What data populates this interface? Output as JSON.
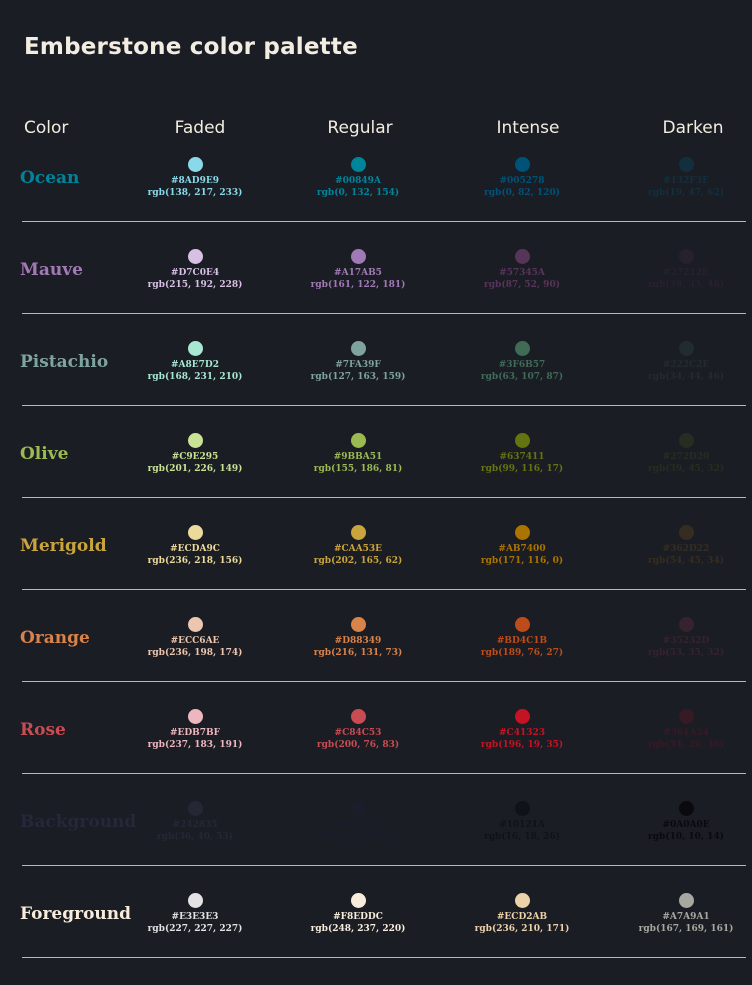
{
  "title": "Emberstone color palette",
  "headers": [
    "Color",
    "Faded",
    "Regular",
    "Intense",
    "Darken"
  ],
  "rows": [
    {
      "name": "Ocean",
      "name_color": "#00849A",
      "swatches": [
        {
          "hex": "#8AD9E9",
          "rgb": "rgb(138, 217, 233)"
        },
        {
          "hex": "#00849A",
          "rgb": "rgb(0, 132, 154)"
        },
        {
          "hex": "#005278",
          "rgb": "rgb(0, 82, 120)"
        },
        {
          "hex": "#132F3E",
          "rgb": "rgb(19, 47, 62)"
        }
      ]
    },
    {
      "name": "Mauve",
      "name_color": "#A17AB5",
      "swatches": [
        {
          "hex": "#D7C0E4",
          "rgb": "rgb(215, 192, 228)"
        },
        {
          "hex": "#A17AB5",
          "rgb": "rgb(161, 122, 181)"
        },
        {
          "hex": "#57345A",
          "rgb": "rgb(87, 52, 90)"
        },
        {
          "hex": "#27212E",
          "rgb": "rgb(39, 33, 46)"
        }
      ]
    },
    {
      "name": "Pistachio",
      "name_color": "#7FA39F",
      "swatches": [
        {
          "hex": "#A8E7D2",
          "rgb": "rgb(168, 231, 210)"
        },
        {
          "hex": "#7FA39F",
          "rgb": "rgb(127, 163, 159)"
        },
        {
          "hex": "#3F6B57",
          "rgb": "rgb(63, 107, 87)"
        },
        {
          "hex": "#222C2E",
          "rgb": "rgb(34, 44, 46)"
        }
      ]
    },
    {
      "name": "Olive",
      "name_color": "#9BBA51",
      "swatches": [
        {
          "hex": "#C9E295",
          "rgb": "rgb(201, 226, 149)"
        },
        {
          "hex": "#9BBA51",
          "rgb": "rgb(155, 186, 81)"
        },
        {
          "hex": "#637411",
          "rgb": "rgb(99, 116, 17)"
        },
        {
          "hex": "#272D20",
          "rgb": "rgb(39, 45, 32)"
        }
      ]
    },
    {
      "name": "Merigold",
      "name_color": "#CAA53E",
      "swatches": [
        {
          "hex": "#ECDA9C",
          "rgb": "rgb(236, 218, 156)"
        },
        {
          "hex": "#CAA53E",
          "rgb": "rgb(202, 165, 62)"
        },
        {
          "hex": "#AB7400",
          "rgb": "rgb(171, 116, 0)"
        },
        {
          "hex": "#362D22",
          "rgb": "rgb(54, 45, 34)"
        }
      ]
    },
    {
      "name": "Orange",
      "name_color": "#D88349",
      "swatches": [
        {
          "hex": "#ECC6AE",
          "rgb": "rgb(236, 198, 174)"
        },
        {
          "hex": "#D88349",
          "rgb": "rgb(216, 131, 73)"
        },
        {
          "hex": "#BD4C1B",
          "rgb": "rgb(189, 76, 27)"
        },
        {
          "hex": "#35232D",
          "rgb": "rgb(53, 35, 32)"
        }
      ]
    },
    {
      "name": "Rose",
      "name_color": "#C84C53",
      "swatches": [
        {
          "hex": "#EDB7BF",
          "rgb": "rgb(237, 183, 191)"
        },
        {
          "hex": "#C84C53",
          "rgb": "rgb(200, 76, 83)"
        },
        {
          "hex": "#C41323",
          "rgb": "rgb(196, 19, 35)"
        },
        {
          "hex": "#361A24",
          "rgb": "rgb(54, 26, 36)"
        }
      ]
    },
    {
      "name": "Background",
      "name_color": "#24283A",
      "swatches": [
        {
          "hex": "#242835",
          "rgb": "rgb(36, 40, 53)"
        },
        {
          "hex": "#1B1D2A",
          "rgb": "rgb(27, 29, 42)"
        },
        {
          "hex": "#10121A",
          "rgb": "rgb(16, 18, 26)"
        },
        {
          "hex": "#0A0A0E",
          "rgb": "rgb(10, 10, 14)"
        }
      ]
    },
    {
      "name": "Foreground",
      "name_color": "#F8EDDC",
      "swatches": [
        {
          "hex": "#E3E3E3",
          "rgb": "rgb(227, 227, 227)"
        },
        {
          "hex": "#F8EDDC",
          "rgb": "rgb(248, 237, 220)"
        },
        {
          "hex": "#ECD2AB",
          "rgb": "rgb(236, 210, 171)"
        },
        {
          "hex": "#A7A9A1",
          "rgb": "rgb(167, 169, 161)"
        }
      ]
    }
  ]
}
